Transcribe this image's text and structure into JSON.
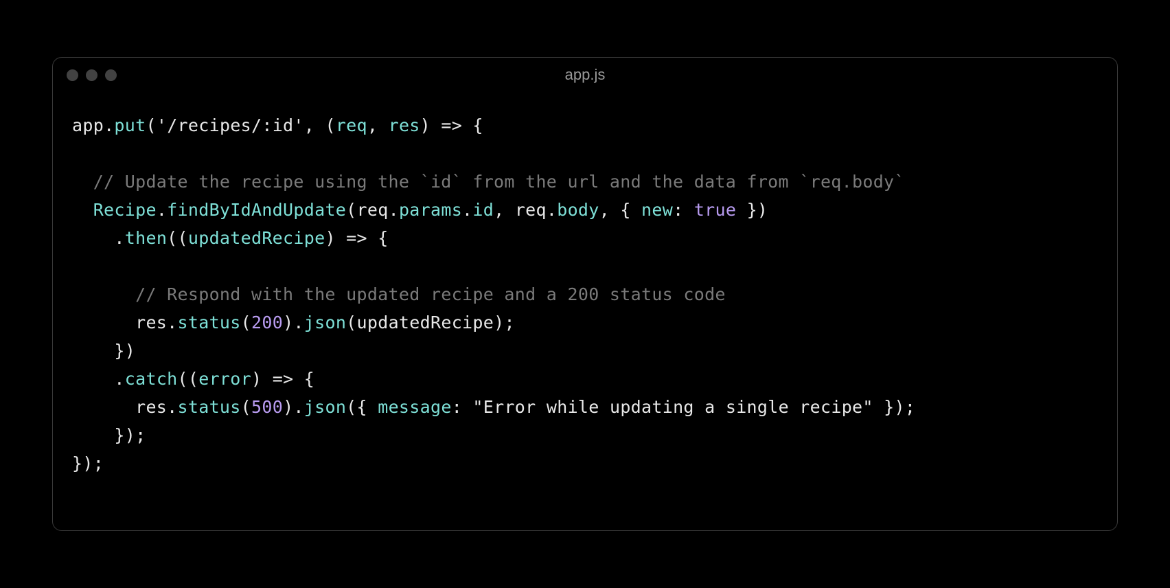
{
  "window": {
    "filename": "app.js"
  },
  "code": {
    "line1": {
      "app": "app",
      "put": "put",
      "route": "'/recipes/:id'",
      "req": "req",
      "res": "res",
      "arrow": " => {"
    },
    "line3": {
      "comment": "  // Update the recipe using the `id` from the url and the data from `req.body`"
    },
    "line4": {
      "indent": "  ",
      "recipe": "Recipe",
      "findByIdAndUpdate": "findByIdAndUpdate",
      "req": "req",
      "params": "params",
      "id": "id",
      "body": "body",
      "new": "new",
      "true": "true"
    },
    "line5": {
      "indent": "    .",
      "then": "then",
      "updatedRecipe": "updatedRecipe",
      "arrow": ") => {"
    },
    "line7": {
      "comment": "      // Respond with the updated recipe and a 200 status code"
    },
    "line8": {
      "indent": "      ",
      "res": "res",
      "status": "status",
      "code200": "200",
      "json": "json",
      "updatedRecipe": "updatedRecipe"
    },
    "line9": {
      "text": "    })"
    },
    "line10": {
      "indent": "    .",
      "catch": "catch",
      "error": "error",
      "arrow": ") => {"
    },
    "line11": {
      "indent": "      ",
      "res": "res",
      "status": "status",
      "code500": "500",
      "json": "json",
      "message": "message",
      "errorText": "\"Error while updating a single recipe\""
    },
    "line12": {
      "text": "    });"
    },
    "line13": {
      "text": "});"
    }
  }
}
